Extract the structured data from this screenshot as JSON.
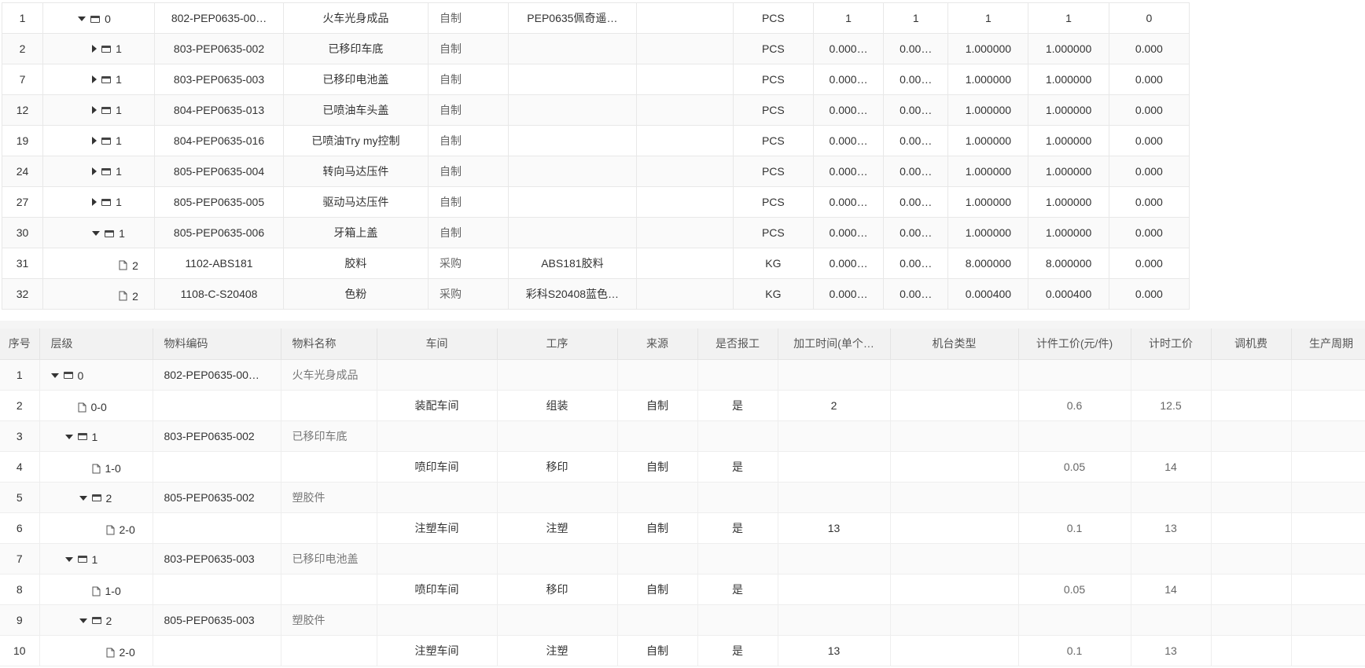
{
  "bom_table": {
    "rows": [
      {
        "seq": "1",
        "toggle": "expanded",
        "icon": "folder",
        "level": "0",
        "code": "802-PEP0635-00…",
        "name": "火车光身成品",
        "source": "自制",
        "spec": "PEP0635佩奇遥…",
        "blank": "",
        "unit": "PCS",
        "c1": "1",
        "c2": "1",
        "c3": "1",
        "c4": "1",
        "c5": "0"
      },
      {
        "seq": "2",
        "toggle": "collapsed",
        "icon": "folder",
        "level": "1",
        "code": "803-PEP0635-002",
        "name": "已移印车底",
        "source": "自制",
        "spec": "",
        "blank": "",
        "unit": "PCS",
        "c1": "0.000…",
        "c2": "0.00…",
        "c3": "1.000000",
        "c4": "1.000000",
        "c5": "0.000"
      },
      {
        "seq": "7",
        "toggle": "collapsed",
        "icon": "folder",
        "level": "1",
        "code": "803-PEP0635-003",
        "name": "已移印电池盖",
        "source": "自制",
        "spec": "",
        "blank": "",
        "unit": "PCS",
        "c1": "0.000…",
        "c2": "0.00…",
        "c3": "1.000000",
        "c4": "1.000000",
        "c5": "0.000"
      },
      {
        "seq": "12",
        "toggle": "collapsed",
        "icon": "folder",
        "level": "1",
        "code": "804-PEP0635-013",
        "name": "已喷油车头盖",
        "source": "自制",
        "spec": "",
        "blank": "",
        "unit": "PCS",
        "c1": "0.000…",
        "c2": "0.00…",
        "c3": "1.000000",
        "c4": "1.000000",
        "c5": "0.000"
      },
      {
        "seq": "19",
        "toggle": "collapsed",
        "icon": "folder",
        "level": "1",
        "code": "804-PEP0635-016",
        "name": "已喷油Try my控制",
        "source": "自制",
        "spec": "",
        "blank": "",
        "unit": "PCS",
        "c1": "0.000…",
        "c2": "0.00…",
        "c3": "1.000000",
        "c4": "1.000000",
        "c5": "0.000"
      },
      {
        "seq": "24",
        "toggle": "collapsed",
        "icon": "folder",
        "level": "1",
        "code": "805-PEP0635-004",
        "name": "转向马达压件",
        "source": "自制",
        "spec": "",
        "blank": "",
        "unit": "PCS",
        "c1": "0.000…",
        "c2": "0.00…",
        "c3": "1.000000",
        "c4": "1.000000",
        "c5": "0.000"
      },
      {
        "seq": "27",
        "toggle": "collapsed",
        "icon": "folder",
        "level": "1",
        "code": "805-PEP0635-005",
        "name": "驱动马达压件",
        "source": "自制",
        "spec": "",
        "blank": "",
        "unit": "PCS",
        "c1": "0.000…",
        "c2": "0.00…",
        "c3": "1.000000",
        "c4": "1.000000",
        "c5": "0.000"
      },
      {
        "seq": "30",
        "toggle": "expanded",
        "icon": "folder",
        "level": "1",
        "code": "805-PEP0635-006",
        "name": "牙箱上盖",
        "source": "自制",
        "spec": "",
        "blank": "",
        "unit": "PCS",
        "c1": "0.000…",
        "c2": "0.00…",
        "c3": "1.000000",
        "c4": "1.000000",
        "c5": "0.000"
      },
      {
        "seq": "31",
        "toggle": "none",
        "icon": "file",
        "level": "2",
        "code": "1102-ABS181",
        "name": "胶料",
        "source": "采购",
        "spec": "ABS181胶料",
        "blank": "",
        "unit": "KG",
        "c1": "0.000…",
        "c2": "0.00…",
        "c3": "8.000000",
        "c4": "8.000000",
        "c5": "0.000"
      },
      {
        "seq": "32",
        "toggle": "none",
        "icon": "file",
        "level": "2",
        "code": "1108-C-S20408",
        "name": "色粉",
        "source": "采购",
        "spec": "彩科S20408蓝色…",
        "blank": "",
        "unit": "KG",
        "c1": "0.000…",
        "c2": "0.00…",
        "c3": "0.000400",
        "c4": "0.000400",
        "c5": "0.000"
      }
    ]
  },
  "route_table": {
    "headers": [
      "序号",
      "层级",
      "物料编码",
      "物料名称",
      "车间",
      "工序",
      "来源",
      "是否报工",
      "加工时间(单个…",
      "机台类型",
      "计件工价(元/件)",
      "计时工价",
      "调机费",
      "生产周期"
    ],
    "rows": [
      {
        "seq": "1",
        "toggle": "expanded",
        "icon": "folder",
        "level": "0",
        "code": "802-PEP0635-00…",
        "name": "火车光身成品",
        "workshop": "",
        "process": "",
        "source": "",
        "report": "",
        "time": "",
        "machine": "",
        "piece": "",
        "hourly": "",
        "setup": "",
        "cycle": ""
      },
      {
        "seq": "2",
        "toggle": "none",
        "icon": "file",
        "level": "0-0",
        "code": "",
        "name": "",
        "workshop": "装配车间",
        "process": "组装",
        "source": "自制",
        "report": "是",
        "time": "2",
        "machine": "",
        "piece": "0.6",
        "hourly": "12.5",
        "setup": "",
        "cycle": ""
      },
      {
        "seq": "3",
        "toggle": "expanded",
        "icon": "folder",
        "level": "1",
        "code": "803-PEP0635-002",
        "name": "已移印车底",
        "workshop": "",
        "process": "",
        "source": "",
        "report": "",
        "time": "",
        "machine": "",
        "piece": "",
        "hourly": "",
        "setup": "",
        "cycle": ""
      },
      {
        "seq": "4",
        "toggle": "none",
        "icon": "file",
        "level": "1-0",
        "code": "",
        "name": "",
        "workshop": "喷印车间",
        "process": "移印",
        "source": "自制",
        "report": "是",
        "time": "",
        "machine": "",
        "piece": "0.05",
        "hourly": "14",
        "setup": "",
        "cycle": ""
      },
      {
        "seq": "5",
        "toggle": "expanded",
        "icon": "folder",
        "level": "2",
        "code": "805-PEP0635-002",
        "name": "塑胶件",
        "workshop": "",
        "process": "",
        "source": "",
        "report": "",
        "time": "",
        "machine": "",
        "piece": "",
        "hourly": "",
        "setup": "",
        "cycle": ""
      },
      {
        "seq": "6",
        "toggle": "none",
        "icon": "file",
        "level": "2-0",
        "code": "",
        "name": "",
        "workshop": "注塑车间",
        "process": "注塑",
        "source": "自制",
        "report": "是",
        "time": "13",
        "machine": "",
        "piece": "0.1",
        "hourly": "13",
        "setup": "",
        "cycle": ""
      },
      {
        "seq": "7",
        "toggle": "expanded",
        "icon": "folder",
        "level": "1",
        "code": "803-PEP0635-003",
        "name": "已移印电池盖",
        "workshop": "",
        "process": "",
        "source": "",
        "report": "",
        "time": "",
        "machine": "",
        "piece": "",
        "hourly": "",
        "setup": "",
        "cycle": ""
      },
      {
        "seq": "8",
        "toggle": "none",
        "icon": "file",
        "level": "1-0",
        "code": "",
        "name": "",
        "workshop": "喷印车间",
        "process": "移印",
        "source": "自制",
        "report": "是",
        "time": "",
        "machine": "",
        "piece": "0.05",
        "hourly": "14",
        "setup": "",
        "cycle": ""
      },
      {
        "seq": "9",
        "toggle": "expanded",
        "icon": "folder",
        "level": "2",
        "code": "805-PEP0635-003",
        "name": "塑胶件",
        "workshop": "",
        "process": "",
        "source": "",
        "report": "",
        "time": "",
        "machine": "",
        "piece": "",
        "hourly": "",
        "setup": "",
        "cycle": ""
      },
      {
        "seq": "10",
        "toggle": "none",
        "icon": "file",
        "level": "2-0",
        "code": "",
        "name": "",
        "workshop": "注塑车间",
        "process": "注塑",
        "source": "自制",
        "report": "是",
        "time": "13",
        "machine": "",
        "piece": "0.1",
        "hourly": "13",
        "setup": "",
        "cycle": ""
      }
    ]
  }
}
